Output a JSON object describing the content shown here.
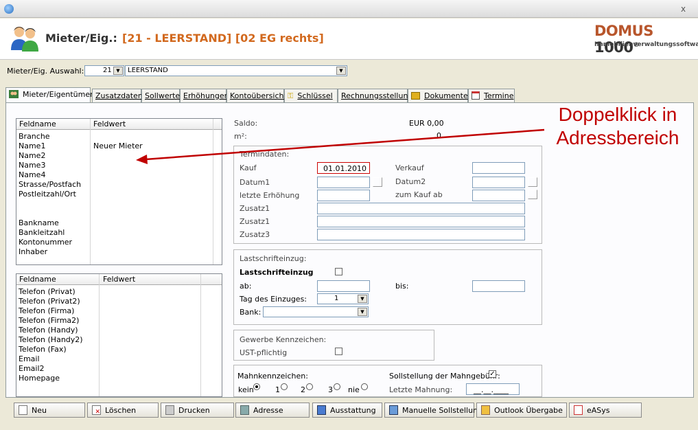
{
  "window": {
    "close_glyph": "x"
  },
  "header": {
    "label": "Mieter/Eig.:",
    "value": "[21 - LEERSTAND] [02 EG rechts]",
    "logo_main_a": "DOMUS ",
    "logo_main_b": "1000",
    "logo_reg": "®",
    "logo_sub": "Immobilienverwaltungssoftware"
  },
  "selector": {
    "label": "Mieter/Eig. Auswahl:",
    "number": "21",
    "name": "LEERSTAND"
  },
  "tabs": [
    {
      "label": "Mieter/Eigentümer",
      "icon": "users-icon"
    },
    {
      "label": "Zusatzdaten"
    },
    {
      "label": "Sollwerte"
    },
    {
      "label": "Erhöhungen"
    },
    {
      "label": "Kontoübersicht"
    },
    {
      "label": "Schlüssel",
      "icon": "key-icon"
    },
    {
      "label": "Rechnungsstellung"
    },
    {
      "label": "Dokumente",
      "icon": "documents-icon"
    },
    {
      "label": "Termine",
      "icon": "calendar-icon"
    }
  ],
  "address_grid": {
    "col_name": "Feldname",
    "col_value": "Feldwert",
    "rows": [
      {
        "name": "Branche",
        "value": ""
      },
      {
        "name": "Name1",
        "value": "Neuer Mieter"
      },
      {
        "name": "Name2",
        "value": ""
      },
      {
        "name": "Name3",
        "value": ""
      },
      {
        "name": "Name4",
        "value": ""
      },
      {
        "name": "Strasse/Postfach",
        "value": ""
      },
      {
        "name": "Postleitzahl/Ort",
        "value": ""
      },
      {
        "name": "",
        "value": ""
      },
      {
        "name": "",
        "value": ""
      },
      {
        "name": "Bankname",
        "value": ""
      },
      {
        "name": "Bankleitzahl",
        "value": ""
      },
      {
        "name": "Kontonummer",
        "value": ""
      },
      {
        "name": "Inhaber",
        "value": ""
      }
    ]
  },
  "contact_grid": {
    "col_name": "Feldname",
    "col_value": "Feldwert",
    "rows": [
      {
        "name": "Telefon (Privat)",
        "value": ""
      },
      {
        "name": "Telefon (Privat2)",
        "value": ""
      },
      {
        "name": "Telefon (Firma)",
        "value": ""
      },
      {
        "name": "Telefon (Firma2)",
        "value": ""
      },
      {
        "name": "Telefon (Handy)",
        "value": ""
      },
      {
        "name": "Telefon (Handy2)",
        "value": ""
      },
      {
        "name": "Telefon (Fax)",
        "value": ""
      },
      {
        "name": "Email",
        "value": ""
      },
      {
        "name": "Email2",
        "value": ""
      },
      {
        "name": "Homepage",
        "value": ""
      }
    ]
  },
  "summary": {
    "saldo_label": "Saldo:",
    "saldo_value": "EUR 0,00",
    "m2_label": "m²:",
    "m2_value": "0"
  },
  "termindaten": {
    "title": "Termindaten:",
    "kauf_label": "Kauf",
    "kauf_value": "01.01.2010",
    "verkauf_label": "Verkauf",
    "datum1_label": "Datum1",
    "datum2_label": "Datum2",
    "letzte_label": "letzte Erhöhung",
    "zumkauf_label": "zum Kauf ab",
    "zusatz1_label": "Zusatz1",
    "zusatz1b_label": "Zusatz1",
    "zusatz3_label": "Zusatz3"
  },
  "lastschrift": {
    "title": "Lastschrifteinzug:",
    "check_label": "Lastschrifteinzug",
    "ab_label": "ab:",
    "bis_label": "bis:",
    "tag_label": "Tag des Einzuges:",
    "tag_value": "1",
    "bank_label": "Bank:"
  },
  "gewerbe": {
    "title": "Gewerbe Kennzeichen:",
    "ust_label": "UST-pflichtig"
  },
  "mahnung": {
    "title": "Mahnkennzeichen:",
    "kein": "kein",
    "r1": "1",
    "r2": "2",
    "r3": "3",
    "nie": "nie",
    "soll_label": "Sollstellung der Mahngebühr:",
    "soll_check": "✓",
    "letzte_label": "Letzte Mahnung:",
    "letzte_value": "__.__.____"
  },
  "buttons": [
    {
      "label": "Neu"
    },
    {
      "label": "Löschen"
    },
    {
      "label": "Drucken"
    },
    {
      "label": "Adresse"
    },
    {
      "label": "Ausstattung"
    },
    {
      "label": "Manuelle Sollstellung"
    },
    {
      "label": "Outlook Übergabe"
    },
    {
      "label": "eASys"
    }
  ],
  "annotation": {
    "line1": "Doppelklick in",
    "line2": "Adressbereich"
  },
  "colors": {
    "accent_orange": "#d2691e",
    "annotation_red": "#c00000"
  }
}
